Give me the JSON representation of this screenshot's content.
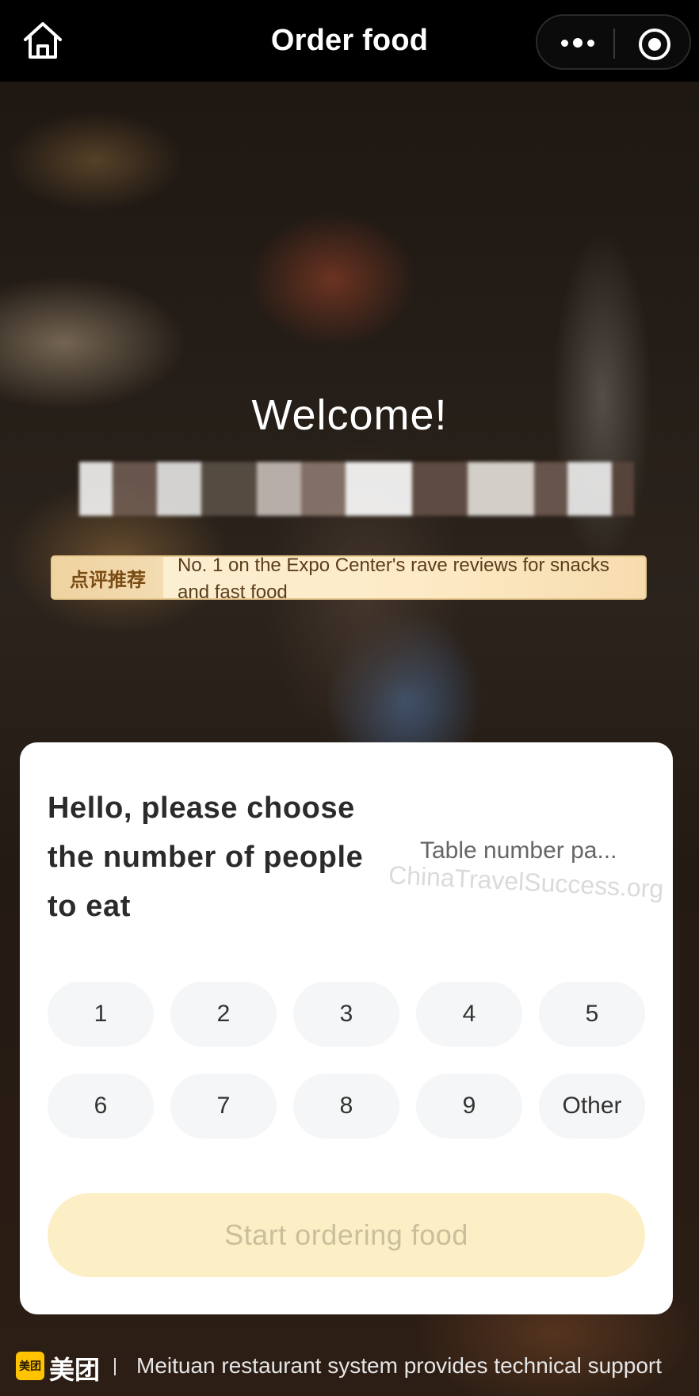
{
  "header": {
    "title": "Order food",
    "home_icon": "home-icon",
    "more_icon": "more-icon",
    "target_icon": "target-icon"
  },
  "hero": {
    "welcome": "Welcome!",
    "recommend_tag": "点评推荐",
    "recommend_text": "No. 1 on the Expo Center's rave reviews for snacks and fast food"
  },
  "card": {
    "prompt": "Hello, please choose the number of people to eat",
    "table_number": "Table number pa...",
    "watermark": "ChinaTravelSuccess.org",
    "options": [
      "1",
      "2",
      "3",
      "4",
      "5",
      "6",
      "7",
      "8",
      "9",
      "Other"
    ],
    "start_button": "Start ordering food"
  },
  "footer": {
    "brand_logo_text": "美团",
    "brand_name": "美团",
    "separator": "I",
    "support_text": "Meituan restaurant system provides technical support"
  },
  "colors": {
    "start_button_bg": "#fcefc5",
    "recommend_bg": "#fdebc7",
    "brand_yellow": "#ffc300"
  }
}
